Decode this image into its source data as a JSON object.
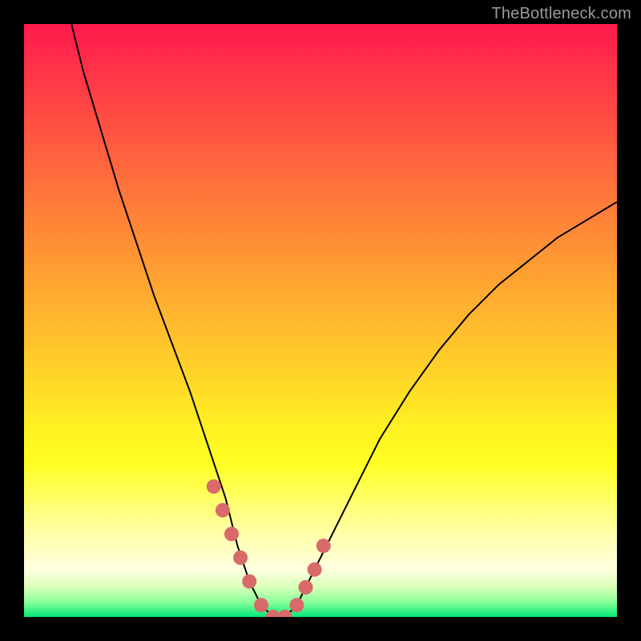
{
  "watermark": "TheBottleneck.com",
  "chart_data": {
    "type": "line",
    "title": "",
    "xlabel": "",
    "ylabel": "",
    "xlim": [
      0,
      100
    ],
    "ylim": [
      0,
      100
    ],
    "series": [
      {
        "name": "curve",
        "x": [
          8,
          10,
          13,
          16,
          19,
          22,
          25,
          28,
          30,
          32,
          34,
          35,
          36,
          38,
          40,
          42,
          44,
          46,
          48,
          52,
          56,
          60,
          65,
          70,
          75,
          80,
          85,
          90,
          95,
          100
        ],
        "y": [
          100,
          92,
          82,
          72,
          63,
          54,
          46,
          38,
          32,
          26,
          20,
          16,
          12,
          6,
          2,
          0,
          0,
          2,
          6,
          14,
          22,
          30,
          38,
          45,
          51,
          56,
          60,
          64,
          67,
          70
        ]
      }
    ],
    "highlighted_points": {
      "x": [
        32,
        33.5,
        35,
        36.5,
        38,
        40,
        42,
        44,
        46,
        47.5,
        49,
        50.5
      ],
      "y": [
        22,
        18,
        14,
        10,
        6,
        2,
        0,
        0,
        2,
        5,
        8,
        12
      ]
    },
    "background_gradient": [
      "#ff1a4d",
      "#ffff22",
      "#00e878"
    ]
  }
}
